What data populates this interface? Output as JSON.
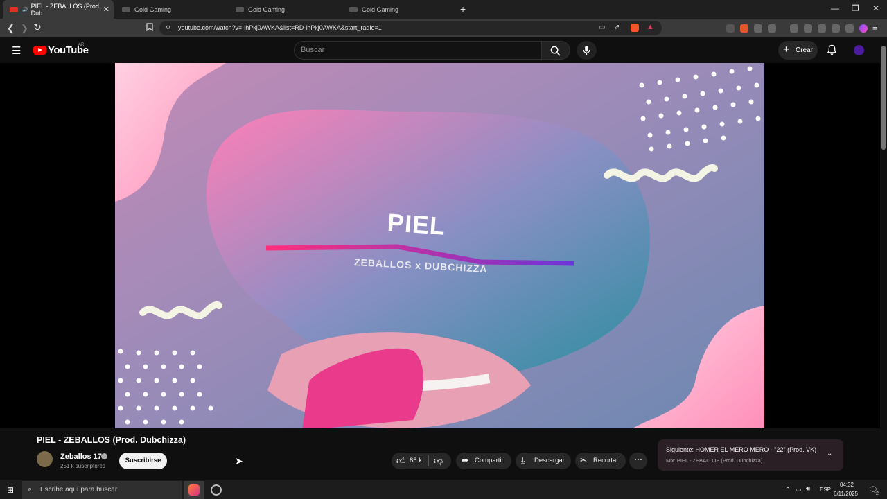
{
  "browser": {
    "tabs": [
      {
        "label": "PIEL - ZEBALLOS (Prod. Dub",
        "favicon": "youtube-icon",
        "active": true
      },
      {
        "label": "Gold Gaming",
        "favicon": "gold-gaming-icon",
        "active": false
      },
      {
        "label": "Gold Gaming",
        "favicon": "gold-gaming-icon",
        "active": false
      },
      {
        "label": "Gold Gaming",
        "favicon": "gold-gaming-icon",
        "active": false
      }
    ],
    "new_tab": "+",
    "url": "youtube.com/watch?v=-ihPkj0AWKA&list=RD-ihPkj0AWKA&start_radio=1"
  },
  "youtube": {
    "logo_text": "YouTube",
    "region": "AR",
    "search_placeholder": "Buscar",
    "create_label": "Crear",
    "accent": "#ff0000"
  },
  "video": {
    "title": "PIEL - ZEBALLOS (Prod. Dubchizza)",
    "art_title": "PIEL",
    "art_subtitle": "ZEBALLOS x DUBCHIZZA",
    "channel": {
      "name": "Zeballos 17",
      "subscribers": "251 k suscriptores",
      "subscribe_label": "Suscribirse"
    },
    "actions": {
      "likes": "85 k",
      "share": "Compartir",
      "download": "Descargar",
      "clip": "Recortar"
    },
    "next": {
      "title": "Siguiente: HOMER EL MERO MERO - \"22\" (Prod. VK)",
      "subtitle": "Mix: PIEL - ZEBALLOS (Prod. Dubchizza)"
    }
  },
  "taskbar": {
    "search_placeholder": "Escribe aquí para buscar",
    "language": "ESP",
    "time": "04:32",
    "date": "6/11/2025",
    "notifications": "2"
  }
}
